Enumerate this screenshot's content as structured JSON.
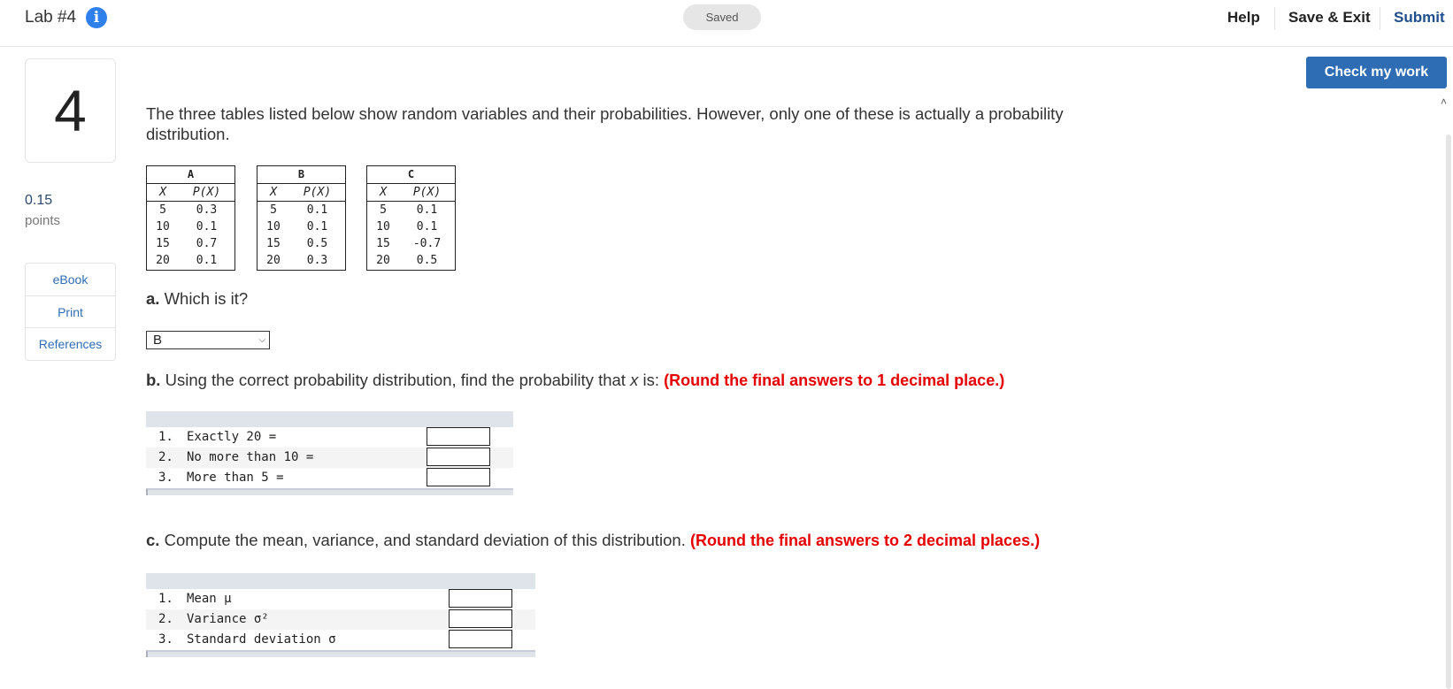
{
  "header": {
    "lab_title": "Lab #4",
    "saved": "Saved",
    "help": "Help",
    "save_exit": "Save & Exit",
    "submit": "Submit"
  },
  "check_my_work": "Check my work",
  "question": {
    "number": "4",
    "points_value": "0.15",
    "points_label": "points",
    "intro": "The three tables listed below show random variables and their probabilities. However, only one of these is actually a probability distribution."
  },
  "sidebar": {
    "ebook": "eBook",
    "print": "Print",
    "references": "References"
  },
  "tables": [
    {
      "title": "A",
      "col_x": "X",
      "col_p": "P(X)",
      "rows": [
        [
          "5",
          "0.3"
        ],
        [
          "10",
          "0.1"
        ],
        [
          "15",
          "0.7"
        ],
        [
          "20",
          "0.1"
        ]
      ]
    },
    {
      "title": "B",
      "col_x": "X",
      "col_p": "P(X)",
      "rows": [
        [
          "5",
          "0.1"
        ],
        [
          "10",
          "0.1"
        ],
        [
          "15",
          "0.5"
        ],
        [
          "20",
          "0.3"
        ]
      ]
    },
    {
      "title": "C",
      "col_x": "X",
      "col_p": "P(X)",
      "rows": [
        [
          "5",
          "0.1"
        ],
        [
          "10",
          "0.1"
        ],
        [
          "15",
          "-0.7"
        ],
        [
          "20",
          "0.5"
        ]
      ]
    }
  ],
  "part_a": {
    "label": "a.",
    "text": "Which is it?",
    "selected": "B"
  },
  "part_b": {
    "label": "b.",
    "text_before": "Using the correct probability distribution, find the probability that ",
    "var": "x",
    "text_after": " is: ",
    "note": "(Round the final answers to 1 decimal place.)",
    "rows": [
      {
        "num": "1.",
        "label": "Exactly 20 ="
      },
      {
        "num": "2.",
        "label": "No more than 10 ="
      },
      {
        "num": "3.",
        "label": "More than 5 ="
      }
    ]
  },
  "part_c": {
    "label": "c.",
    "text": "Compute the mean, variance, and standard deviation of this distribution. ",
    "note": "(Round the final answers to 2 decimal places.)",
    "rows": [
      {
        "num": "1.",
        "label": "Mean μ"
      },
      {
        "num": "2.",
        "label": "Variance σ²"
      },
      {
        "num": "3.",
        "label": "Standard deviation σ"
      }
    ]
  }
}
